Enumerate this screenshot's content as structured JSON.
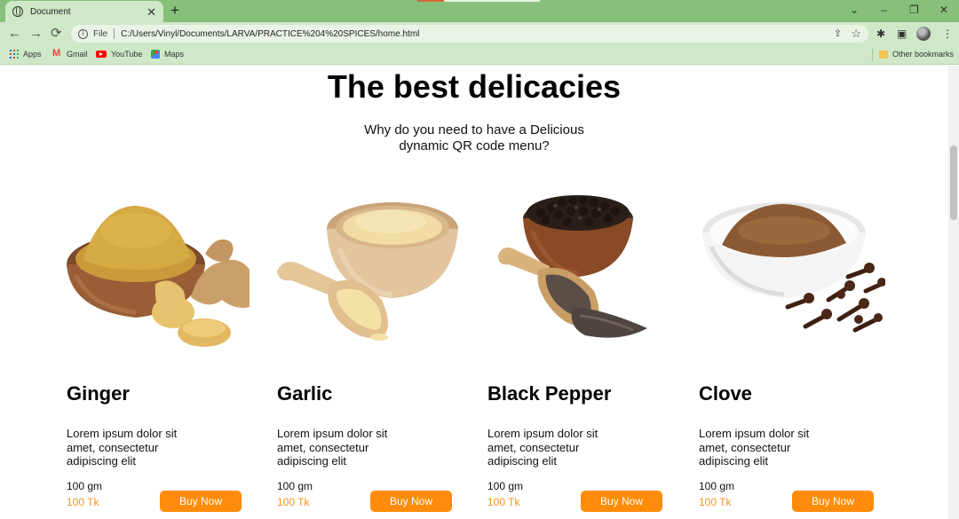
{
  "browser": {
    "tab_title": "Document",
    "file_label": "File",
    "url": "C:/Users/Vinyl/Documents/LARVA/PRACTICE%204%20SPICES/home.html",
    "bookmarks": [
      {
        "label": "Apps",
        "icon": "apps-grid-icon"
      },
      {
        "label": "Gmail",
        "icon": "gmail-icon"
      },
      {
        "label": "YouTube",
        "icon": "youtube-icon"
      },
      {
        "label": "Maps",
        "icon": "maps-icon"
      }
    ],
    "other_bookmarks": "Other bookmarks"
  },
  "page": {
    "heading": "The best delicacies",
    "subheading": "Why do you need to have a Delicious dynamic QR code menu?",
    "products": [
      {
        "name": "Ginger",
        "description": "Lorem ipsum dolor sit amet, consectetur adipiscing elit",
        "weight": "100 gm",
        "price": "100 Tk",
        "button": "Buy Now",
        "image": "ginger-powder-bowl"
      },
      {
        "name": "Garlic",
        "description": "Lorem ipsum dolor sit amet, consectetur adipiscing elit",
        "weight": "100 gm",
        "price": "100 Tk",
        "button": "Buy Now",
        "image": "garlic-powder-bowl"
      },
      {
        "name": "Black Pepper",
        "description": "Lorem ipsum dolor sit amet, consectetur adipiscing elit",
        "weight": "100 gm",
        "price": "100 Tk",
        "button": "Buy Now",
        "image": "black-pepper-bowl"
      },
      {
        "name": "Clove",
        "description": "Lorem ipsum dolor sit amet, consectetur adipiscing elit",
        "weight": "100 gm",
        "price": "100 Tk",
        "button": "Buy Now",
        "image": "clove-powder-bowl"
      }
    ]
  },
  "colors": {
    "chrome_frame": "#86c07a",
    "chrome_toolbar": "#cfe8c8",
    "button": "#ff8c0a",
    "price": "#f7941d"
  }
}
